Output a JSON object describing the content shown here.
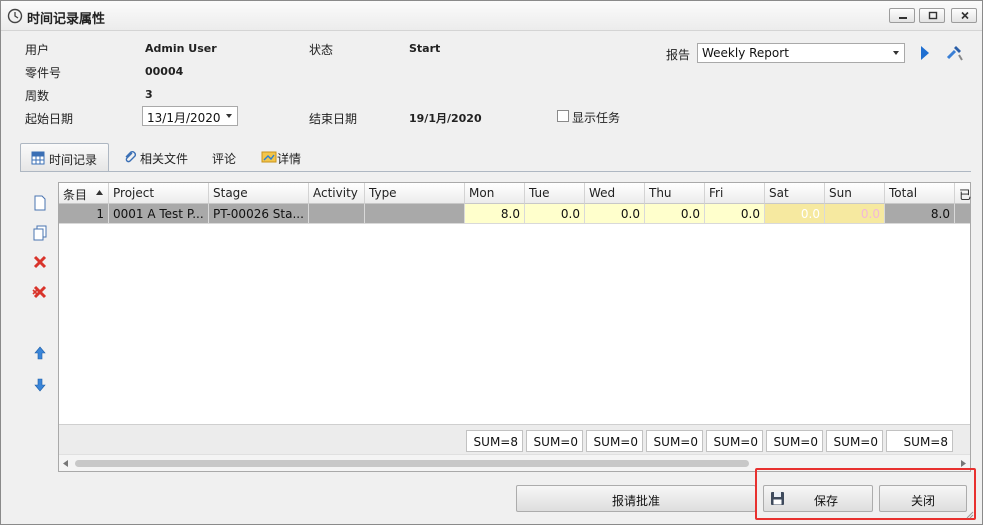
{
  "window": {
    "title": "时间记录属性"
  },
  "form": {
    "user_label": "用户",
    "user_value": "Admin User",
    "part_label": "零件号",
    "part_value": "00004",
    "week_label": "周数",
    "week_value": "3",
    "start_label": "起始日期",
    "start_value": "13/1月/2020",
    "status_label": "状态",
    "status_value": "Start",
    "end_label": "结束日期",
    "end_value": "19/1月/2020",
    "show_tasks_label": "显示任务",
    "report_label": "报告",
    "report_value": "Weekly Report"
  },
  "tabs": [
    {
      "label": "时间记录",
      "icon": "grid-icon"
    },
    {
      "label": "相关文件",
      "icon": "paperclip-icon"
    },
    {
      "label": "评论"
    },
    {
      "label": "详情",
      "icon": "details-icon"
    }
  ],
  "grid": {
    "columns": [
      "条目",
      "Project",
      "Stage",
      "Activity",
      "Type",
      "Mon",
      "Tue",
      "Wed",
      "Thu",
      "Fri",
      "Sat",
      "Sun",
      "Total",
      "已"
    ],
    "rows": [
      {
        "entry": "1",
        "project": "0001 A Test P...",
        "stage": "PT-00026 Sta...",
        "activity": "",
        "type": "",
        "mon": "8.0",
        "tue": "0.0",
        "wed": "0.0",
        "thu": "0.0",
        "fri": "0.0",
        "sat": "0.0",
        "sun": "0.0",
        "total": "8.0"
      }
    ],
    "sums": [
      "SUM=8",
      "SUM=0",
      "SUM=0",
      "SUM=0",
      "SUM=0",
      "SUM=0",
      "SUM=0",
      "SUM=8"
    ]
  },
  "buttons": {
    "submit": "报请批准",
    "save": "保存",
    "close": "关闭"
  },
  "colors": {
    "highlight": "#e8312f",
    "weekday_bg": "#ffffcc",
    "weekend_bg": "#f6e9a0",
    "accent": "#1f6fd1"
  }
}
